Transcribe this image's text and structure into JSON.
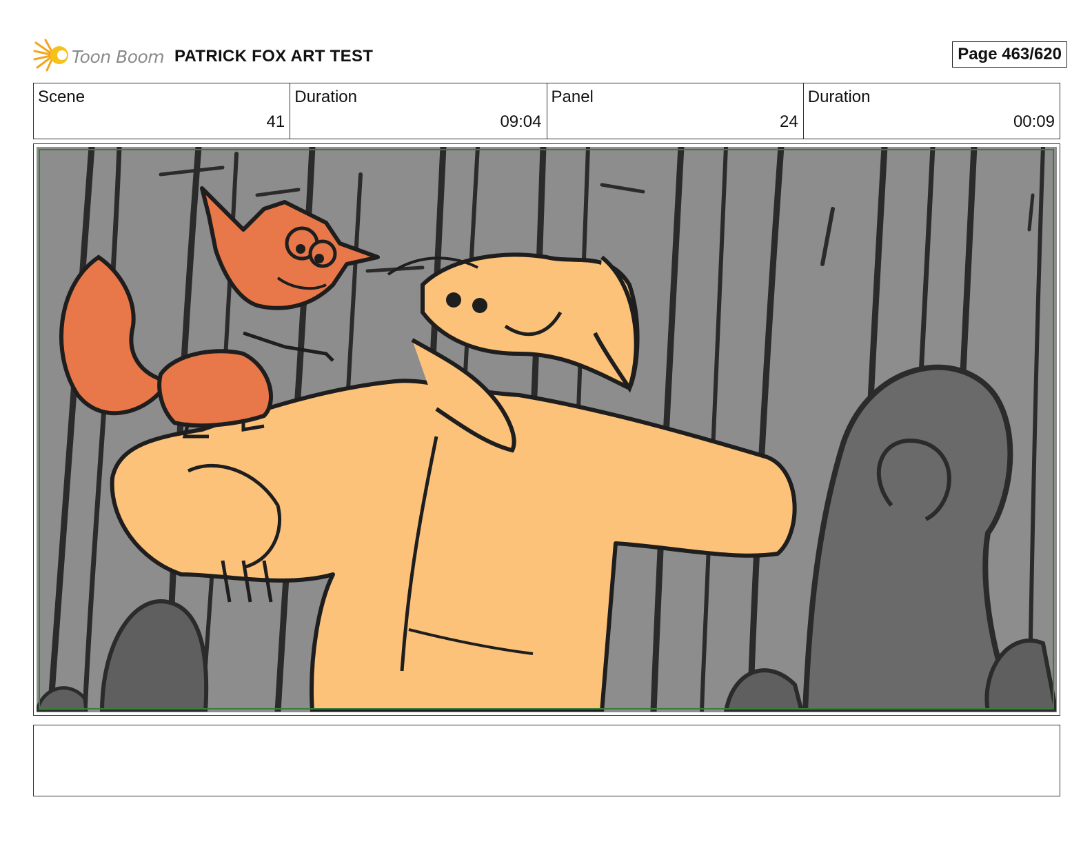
{
  "header": {
    "logo_text": "Toon Boom",
    "project_title": "PATRICK FOX ART TEST",
    "page_label": "Page 463/620"
  },
  "info": [
    {
      "label": "Scene",
      "value": "41"
    },
    {
      "label": "Duration",
      "value": "09:04"
    },
    {
      "label": "Panel",
      "value": "24"
    },
    {
      "label": "Duration",
      "value": "00:09"
    }
  ],
  "panel": {
    "content": "storyboard-sketch",
    "colors": {
      "background": "#8d8d8d",
      "trees": "#2b2b2b",
      "bushes": "#5f5f5f",
      "fox": "#e8784a",
      "dog": "#fcc27a",
      "frame_guide": "#3a7d3a"
    }
  },
  "notes": {
    "text": ""
  },
  "brand": {
    "logo_colors": [
      "#f6c21a",
      "#f39a1b"
    ]
  }
}
